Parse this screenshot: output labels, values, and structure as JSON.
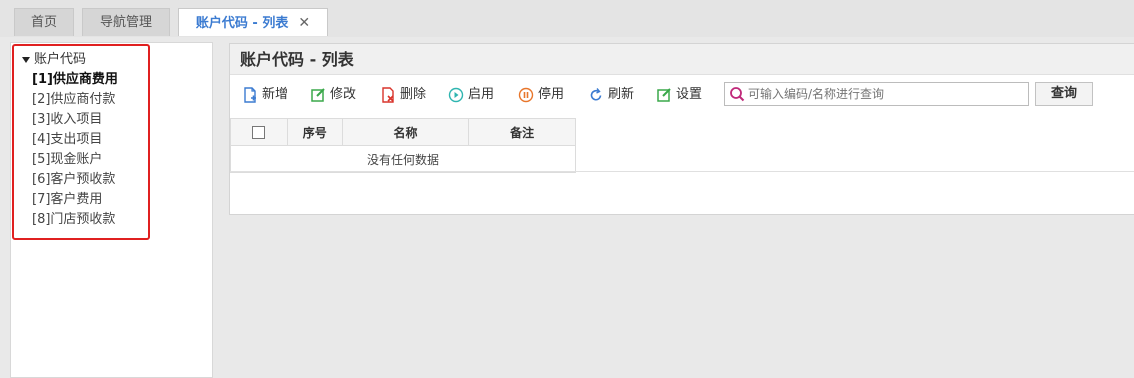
{
  "tabs": [
    {
      "label": "首页"
    },
    {
      "label": "导航管理"
    },
    {
      "label": "账户代码 - 列表",
      "close": "✕"
    }
  ],
  "tree": {
    "root": "账户代码",
    "items": [
      "[1]供应商费用",
      "[2]供应商付款",
      "[3]收入项目",
      "[4]支出项目",
      "[5]现金账户",
      "[6]客户预收款",
      "[7]客户费用",
      "[8]门店预收款"
    ]
  },
  "panel": {
    "title": "账户代码 - 列表",
    "toolbar": {
      "add": "新增",
      "edit": "修改",
      "delete": "删除",
      "enable": "启用",
      "disable": "停用",
      "refresh": "刷新",
      "settings": "设置"
    },
    "search": {
      "placeholder": "可输入编码/名称进行查询",
      "button": "查询"
    },
    "table": {
      "columns": [
        "序号",
        "名称",
        "备注"
      ],
      "empty": "没有任何数据"
    }
  },
  "colors": {
    "accent": "#3b7bd1",
    "highlight": "#e02020"
  }
}
